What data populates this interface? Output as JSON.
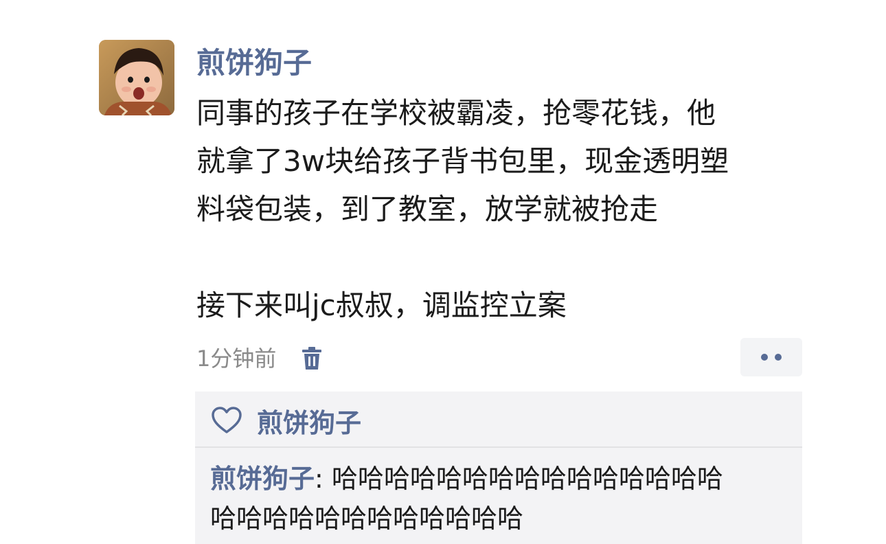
{
  "post": {
    "author": "煎饼狗子",
    "text_lines": [
      "同事的孩子在学校被霸凌，抢零花钱，他",
      "就拿了3w块给孩子背书包里，现金透明塑",
      "料袋包装，到了教室，放学就被抢走",
      "",
      "接下来叫jc叔叔，调监控立案"
    ],
    "time": "1分钟前"
  },
  "icons": {
    "delete": "trash-icon",
    "more": "more-dots-icon",
    "like": "heart-icon"
  },
  "likes": {
    "names": "煎饼狗子"
  },
  "comment": {
    "commenter": "煎饼狗子",
    "separator": ": ",
    "text_line_1": "哈哈哈哈哈哈哈哈哈哈哈哈哈哈哈",
    "text_line_2": "哈哈哈哈哈哈哈哈哈哈哈哈"
  },
  "colors": {
    "link": "#576b95",
    "text": "#1b1b1b",
    "meta": "#8a8a8a",
    "panel": "#f3f3f5"
  }
}
